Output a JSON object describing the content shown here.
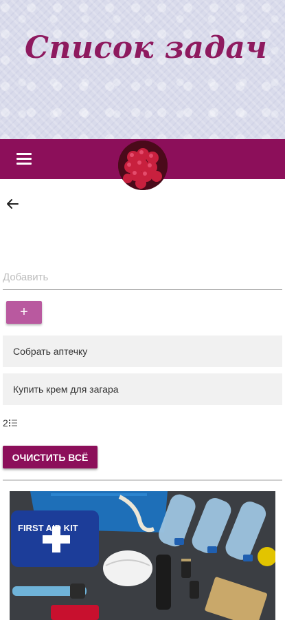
{
  "header": {
    "title": "Список задач"
  },
  "nav": {
    "menu_icon": "hamburger-menu-icon",
    "back_icon": "arrow-left-icon",
    "bar_color": "#8c0f5a"
  },
  "form": {
    "placeholder": "Добавить",
    "add_label": "+"
  },
  "tasks": [
    {
      "label": "Собрать аптечку"
    },
    {
      "label": "Купить крем для загара"
    }
  ],
  "counter": {
    "value": "2",
    "icon": "list-icon"
  },
  "actions": {
    "clear_label": "ОЧИСТИТЬ ВСЁ"
  },
  "photo": {
    "kit_label": "FIRST AID KIT"
  },
  "colors": {
    "accent": "#8c0f5a",
    "button_light": "#b9599f",
    "title": "#8e1a5f"
  }
}
